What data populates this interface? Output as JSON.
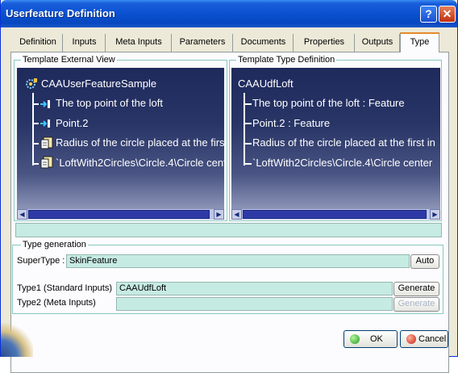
{
  "window": {
    "title": "Userfeature Definition",
    "help_label": "?",
    "close_label": "✕"
  },
  "tabs": [
    {
      "label": "Definition"
    },
    {
      "label": "Inputs"
    },
    {
      "label": "Meta Inputs"
    },
    {
      "label": "Parameters"
    },
    {
      "label": "Documents"
    },
    {
      "label": "Properties"
    },
    {
      "label": "Outputs"
    },
    {
      "label": "Type",
      "active": true
    }
  ],
  "external_view": {
    "label": "Template External View",
    "root": "CAAUserFeatureSample",
    "items": [
      {
        "text": "The top point of the loft",
        "icon": "input-arrow-icon"
      },
      {
        "text": "Point.2",
        "icon": "input-arrow-icon"
      },
      {
        "text": "Radius of the circle placed at the first",
        "icon": "parameter-sheet-icon"
      },
      {
        "text": "`LoftWith2Circles\\Circle.4\\Circle center",
        "icon": "parameter-sheet-icon"
      }
    ]
  },
  "type_definition": {
    "label": "Template Type Definition",
    "root": "CAAUdfLoft",
    "items": [
      {
        "text": "The top point of the loft : Feature"
      },
      {
        "text": "Point.2 : Feature"
      },
      {
        "text": "Radius of the circle placed at the first in"
      },
      {
        "text": "`LoftWith2Circles\\Circle.4\\Circle center"
      }
    ]
  },
  "type_generation": {
    "label": "Type generation",
    "supertype_label": "SuperType :",
    "supertype_value": "SkinFeature",
    "auto_label": "Auto",
    "type1_label": "Type1 (Standard Inputs)",
    "type1_value": "CAAUdfLoft",
    "type2_label": "Type2 (Meta Inputs)",
    "type2_value": "",
    "generate_label": "Generate",
    "generate2_label": "Generate"
  },
  "footer": {
    "ok_label": "OK",
    "cancel_label": "Cancel"
  },
  "colors": {
    "tree_bg": "#283566",
    "field_bg": "#c6ebe3",
    "title_bar": "#0a50d0"
  }
}
